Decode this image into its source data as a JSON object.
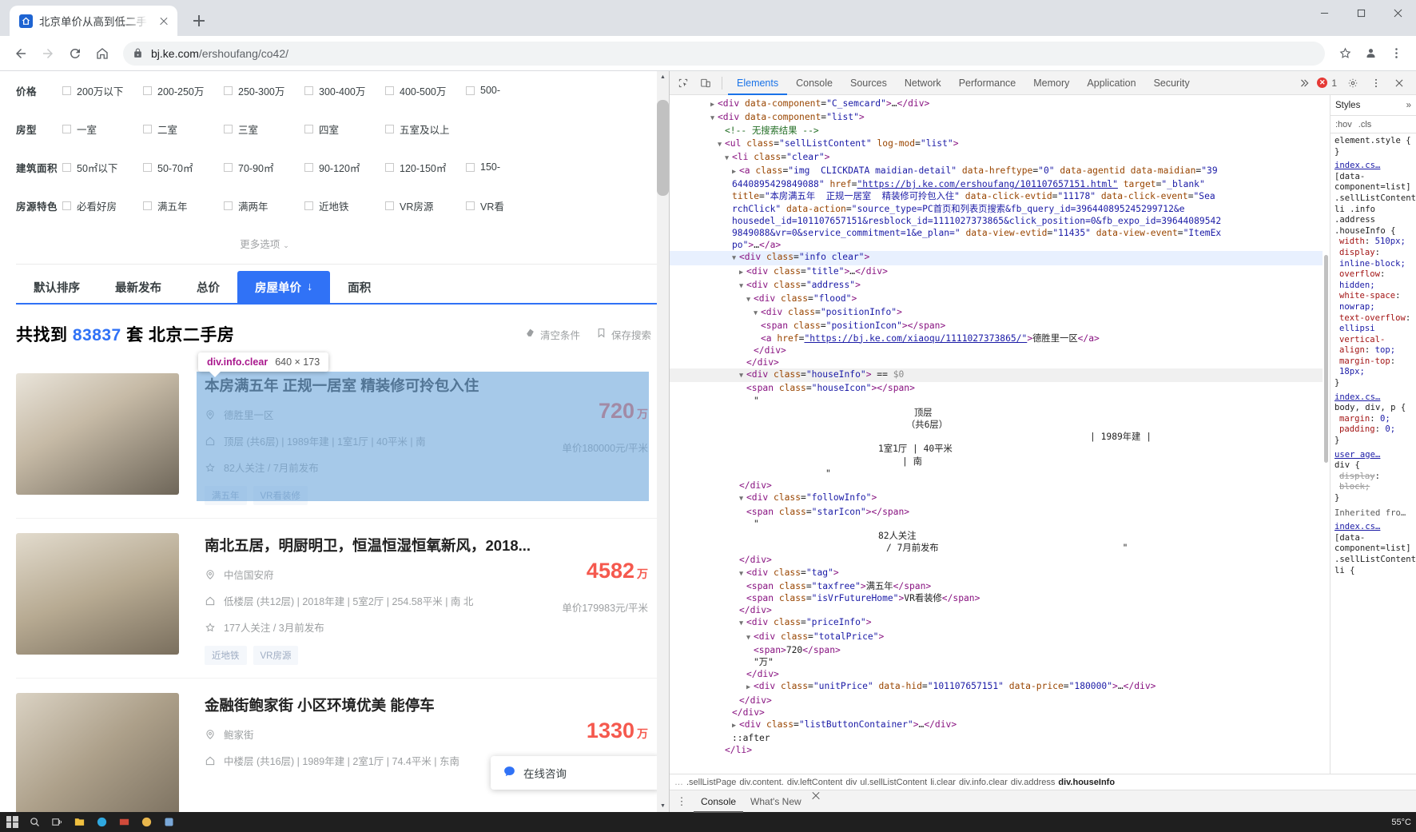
{
  "browser": {
    "tab_title": "北京单价从高到低二手房_北京单",
    "new_tab_label": "+",
    "url_host": "bj.ke.com",
    "url_path": "/ershoufang/co42/",
    "back_icon": "back-arrow-icon",
    "forward_icon": "forward-arrow-icon",
    "reload_icon": "reload-icon",
    "home_icon": "home-icon",
    "lock_icon": "lock-icon",
    "star_icon": "bookmark-star-icon",
    "profile_icon": "profile-avatar-icon",
    "menu_icon": "three-dot-menu-icon",
    "minimize_icon": "minimize-icon",
    "maximize_icon": "maximize-icon",
    "close_icon": "close-icon"
  },
  "filters": {
    "rows": [
      {
        "label": "价格",
        "items": [
          "200万以下",
          "200-250万",
          "250-300万",
          "300-400万",
          "400-500万",
          "500-"
        ]
      },
      {
        "label": "房型",
        "items": [
          "一室",
          "二室",
          "三室",
          "四室",
          "五室及以上",
          ""
        ]
      },
      {
        "label": "建筑面积",
        "items": [
          "50㎡以下",
          "50-70㎡",
          "70-90㎡",
          "90-120㎡",
          "120-150㎡",
          "150-"
        ]
      },
      {
        "label": "房源特色",
        "items": [
          "必看好房",
          "满五年",
          "满两年",
          "近地铁",
          "VR房源",
          "VR看"
        ]
      }
    ],
    "more_label": "更多选项",
    "more_chevron": "chevron-down-icon"
  },
  "sort": {
    "tabs": [
      {
        "label": "默认排序",
        "active": false
      },
      {
        "label": "最新发布",
        "active": false
      },
      {
        "label": "总价",
        "active": false
      },
      {
        "label": "房屋单价",
        "active": true,
        "arrow": "↓"
      },
      {
        "label": "面积",
        "active": false
      }
    ]
  },
  "results": {
    "prefix": "共找到",
    "count": "83837",
    "suffix": "套 北京二手房",
    "clear_label": "清空条件",
    "clear_icon": "eraser-icon",
    "save_label": "保存搜索",
    "save_icon": "bookmark-icon"
  },
  "listings": [
    {
      "title": "本房满五年 正规一居室 精装修可拎包入住",
      "community": "德胜里一区",
      "community_icon": "location-pin-icon",
      "detail": "顶层 (共6层) | 1989年建 | 1室1厅 | 40平米 | 南",
      "detail_icon": "house-icon",
      "follow": "82人关注 / 7月前发布",
      "follow_icon": "star-icon",
      "tags": [
        "满五年",
        "VR看装修"
      ],
      "total_price": "720",
      "total_unit": "万",
      "unit_price": "单价180000元/平米",
      "highlighted": true
    },
    {
      "title": "南北五居，明厨明卫，恒温恒湿恒氧新风，2018...",
      "community": "中信国安府",
      "community_icon": "location-pin-icon",
      "detail": "低楼层 (共12层) | 2018年建 | 5室2厅 | 254.58平米 | 南 北",
      "detail_icon": "house-icon",
      "follow": "177人关注 / 3月前发布",
      "follow_icon": "star-icon",
      "tags": [
        "近地铁",
        "VR房源"
      ],
      "total_price": "4582",
      "total_unit": "万",
      "unit_price": "单价179983元/平米",
      "highlighted": false
    },
    {
      "title": "金融街鲍家街 小区环境优美 能停车",
      "community": "鲍家街",
      "community_icon": "location-pin-icon",
      "detail": "中楼层 (共16层) | 1989年建 | 2室1厅 | 74.4平米 | 东南",
      "detail_icon": "house-icon",
      "follow": "",
      "follow_icon": "star-icon",
      "tags": [],
      "total_price": "1330",
      "total_unit": "万",
      "unit_price": "",
      "highlighted": false
    }
  ],
  "inspector_tooltip": {
    "selector": "div.info.clear",
    "dimensions": "640 × 173"
  },
  "chat_widget": {
    "label": "在线咨询",
    "icon": "chat-bubble-icon"
  },
  "devtools": {
    "inspect_icon": "inspect-element-icon",
    "device_icon": "device-toolbar-icon",
    "tabs": [
      {
        "label": "Elements",
        "active": true
      },
      {
        "label": "Console",
        "active": false
      },
      {
        "label": "Sources",
        "active": false
      },
      {
        "label": "Network",
        "active": false
      },
      {
        "label": "Performance",
        "active": false
      },
      {
        "label": "Memory",
        "active": false
      },
      {
        "label": "Application",
        "active": false
      },
      {
        "label": "Security",
        "active": false
      }
    ],
    "overflow_icon": "chevron-double-right-icon",
    "error_count": "1",
    "settings_icon": "gear-icon",
    "kebab_icon": "three-dot-menu-icon",
    "close_icon": "close-icon",
    "dom_lines": [
      {
        "indent": 5,
        "html": "<span class=\"tri\">▶</span><span class=\"tagc\">&lt;div</span> <span class=\"attr\">data-component</span>=<span class=\"val\">\"C_semcard\"</span><span class=\"tagc\">&gt;</span><span class=\"txt\">…</span><span class=\"tagc\">&lt;/div&gt;</span>",
        "state": ""
      },
      {
        "indent": 5,
        "html": "<span class=\"tri\">▼</span><span class=\"tagc\">&lt;div</span> <span class=\"attr\">data-component</span>=<span class=\"val\">\"list\"</span><span class=\"tagc\">&gt;</span>",
        "state": ""
      },
      {
        "indent": 7,
        "html": "<span class=\"cmt\">&lt;!-- 无搜索结果 --&gt;</span>",
        "state": ""
      },
      {
        "indent": 6,
        "html": "<span class=\"tri\">▼</span><span class=\"tagc\">&lt;ul</span> <span class=\"attr\">class</span>=<span class=\"val\">\"sellListContent\"</span> <span class=\"attr\">log-mod</span>=<span class=\"val\">\"list\"</span><span class=\"tagc\">&gt;</span>",
        "state": ""
      },
      {
        "indent": 7,
        "html": "<span class=\"tri\">▼</span><span class=\"tagc\">&lt;li</span> <span class=\"attr\">class</span>=<span class=\"val\">\"clear\"</span><span class=\"tagc\">&gt;</span>",
        "state": ""
      },
      {
        "indent": 8,
        "html": "<span class=\"tri\">▶</span><span class=\"tagc\">&lt;a</span> <span class=\"attr\">class</span>=<span class=\"val\">\"img  CLICKDATA maidian-detail\"</span> <span class=\"attr\">data-hreftype</span>=<span class=\"val\">\"0\"</span> <span class=\"attr\">data-agentid</span> <span class=\"attr\">data-maidian</span>=<span class=\"val\">\"39</span>",
        "state": ""
      },
      {
        "indent": 8,
        "html": "<span class=\"val\">6440895429849088\"</span> <span class=\"attr\">href</span>=<span class=\"lnk\">\"https://bj.ke.com/ershoufang/101107657151.html\"</span> <span class=\"attr\">target</span>=<span class=\"val\">\"_blank\"</span>",
        "state": ""
      },
      {
        "indent": 8,
        "html": "<span class=\"attr\">title</span>=<span class=\"val\">\"本房满五年  正规一居室  精装修可拎包入住\"</span> <span class=\"attr\">data-click-evtid</span>=<span class=\"val\">\"11178\"</span> <span class=\"attr\">data-click-event</span>=<span class=\"val\">\"Sea</span>",
        "state": ""
      },
      {
        "indent": 8,
        "html": "<span class=\"val\">rchClick\"</span> <span class=\"attr\">data-action</span>=<span class=\"val\">\"source_type=PC首页和列表页搜索&amp;fb_query_id=396440895245299712&amp;e</span>",
        "state": ""
      },
      {
        "indent": 8,
        "html": "<span class=\"val\">housedel_id=101107657151&amp;resblock_id=1111027373865&amp;click_position=0&amp;fb_expo_id=39644089542</span>",
        "state": ""
      },
      {
        "indent": 8,
        "html": "<span class=\"val\">9849088&amp;vr=0&amp;service_commitment=1&amp;e_plan=\"</span> <span class=\"attr\">data-view-evtid</span>=<span class=\"val\">\"11435\"</span> <span class=\"attr\">data-view-event</span>=<span class=\"val\">\"ItemEx</span>",
        "state": ""
      },
      {
        "indent": 8,
        "html": "<span class=\"val\">po\"</span><span class=\"tagc\">&gt;</span><span class=\"txt\">…</span><span class=\"tagc\">&lt;/a&gt;</span>",
        "state": ""
      },
      {
        "indent": 8,
        "html": "<span class=\"tri\">▼</span><span class=\"tagc\">&lt;div</span> <span class=\"attr\">class</span>=<span class=\"val\">\"info clear\"</span><span class=\"tagc\">&gt;</span>",
        "state": "sel"
      },
      {
        "indent": 9,
        "html": "<span class=\"tri\">▶</span><span class=\"tagc\">&lt;div</span> <span class=\"attr\">class</span>=<span class=\"val\">\"title\"</span><span class=\"tagc\">&gt;</span><span class=\"txt\">…</span><span class=\"tagc\">&lt;/div&gt;</span>",
        "state": ""
      },
      {
        "indent": 9,
        "html": "<span class=\"tri\">▼</span><span class=\"tagc\">&lt;div</span> <span class=\"attr\">class</span>=<span class=\"val\">\"address\"</span><span class=\"tagc\">&gt;</span>",
        "state": ""
      },
      {
        "indent": 10,
        "html": "<span class=\"tri\">▼</span><span class=\"tagc\">&lt;div</span> <span class=\"attr\">class</span>=<span class=\"val\">\"flood\"</span><span class=\"tagc\">&gt;</span>",
        "state": ""
      },
      {
        "indent": 11,
        "html": "<span class=\"tri\">▼</span><span class=\"tagc\">&lt;div</span> <span class=\"attr\">class</span>=<span class=\"val\">\"positionInfo\"</span><span class=\"tagc\">&gt;</span>",
        "state": ""
      },
      {
        "indent": 12,
        "html": "<span class=\"tagc\">&lt;span</span> <span class=\"attr\">class</span>=<span class=\"val\">\"positionIcon\"</span><span class=\"tagc\">&gt;&lt;/span&gt;</span>",
        "state": ""
      },
      {
        "indent": 12,
        "html": "<span class=\"tagc\">&lt;a</span> <span class=\"attr\">href</span>=<span class=\"lnk\">\"https://bj.ke.com/xiaoqu/1111027373865/\"</span><span class=\"tagc\">&gt;</span><span class=\"txt\">德胜里一区</span><span class=\"tagc\">&lt;/a&gt;</span>",
        "state": ""
      },
      {
        "indent": 11,
        "html": "<span class=\"tagc\">&lt;/div&gt;</span>",
        "state": ""
      },
      {
        "indent": 10,
        "html": "<span class=\"tagc\">&lt;/div&gt;</span>",
        "state": ""
      },
      {
        "indent": 9,
        "html": "<span class=\"tri\">▼</span><span class=\"tagc\">&lt;div</span> <span class=\"attr\">class</span>=<span class=\"val\">\"houseInfo\"</span><span class=\"tagc\">&gt;</span> == <span class=\"eq0\">$0</span>",
        "state": "sel2"
      },
      {
        "indent": 10,
        "html": "<span class=\"tagc\">&lt;span</span> <span class=\"attr\">class</span>=<span class=\"val\">\"houseIcon\"</span><span class=\"tagc\">&gt;&lt;/span&gt;</span>",
        "state": ""
      },
      {
        "indent": 11,
        "html": "<span class=\"txt\">\"</span>",
        "state": ""
      },
      {
        "indent": 0,
        "html": "<span class=\"txt\" style=\"margin-left:300px\">顶层</span>",
        "state": ""
      },
      {
        "indent": 0,
        "html": "<span class=\"txt\" style=\"margin-left:290px\">（共6层）</span>",
        "state": ""
      },
      {
        "indent": 0,
        "html": "<span class=\"txt\" style=\"margin-left:520px\">| 1989年建 |</span>",
        "state": ""
      },
      {
        "indent": 0,
        "html": "<span class=\"txt\" style=\"margin-left:255px\">1室1厅 | 40平米</span>",
        "state": ""
      },
      {
        "indent": 0,
        "html": "<span class=\"txt\" style=\"margin-left:285px\">| 南</span>",
        "state": ""
      },
      {
        "indent": 11,
        "html": "<span class=\"txt\" style=\"margin-left:90px\">\"</span>",
        "state": ""
      },
      {
        "indent": 9,
        "html": "<span class=\"tagc\">&lt;/div&gt;</span>",
        "state": ""
      },
      {
        "indent": 9,
        "html": "<span class=\"tri\">▼</span><span class=\"tagc\">&lt;div</span> <span class=\"attr\">class</span>=<span class=\"val\">\"followInfo\"</span><span class=\"tagc\">&gt;</span>",
        "state": ""
      },
      {
        "indent": 10,
        "html": "<span class=\"tagc\">&lt;span</span> <span class=\"attr\">class</span>=<span class=\"val\">\"starIcon\"</span><span class=\"tagc\">&gt;&lt;/span&gt;</span>",
        "state": ""
      },
      {
        "indent": 11,
        "html": "<span class=\"txt\">\"</span>",
        "state": ""
      },
      {
        "indent": 0,
        "html": "<span class=\"txt\" style=\"margin-left:255px\">82人关注</span>",
        "state": ""
      },
      {
        "indent": 0,
        "html": "<span class=\"txt\" style=\"margin-left:265px\">/ 7月前发布</span><span class=\"txt\" style=\"margin-left:230px\">\"</span>",
        "state": ""
      },
      {
        "indent": 9,
        "html": "<span class=\"tagc\">&lt;/div&gt;</span>",
        "state": ""
      },
      {
        "indent": 9,
        "html": "<span class=\"tri\">▼</span><span class=\"tagc\">&lt;div</span> <span class=\"attr\">class</span>=<span class=\"val\">\"tag\"</span><span class=\"tagc\">&gt;</span>",
        "state": ""
      },
      {
        "indent": 10,
        "html": "<span class=\"tagc\">&lt;span</span> <span class=\"attr\">class</span>=<span class=\"val\">\"taxfree\"</span><span class=\"tagc\">&gt;</span><span class=\"txt\">满五年</span><span class=\"tagc\">&lt;/span&gt;</span>",
        "state": ""
      },
      {
        "indent": 10,
        "html": "<span class=\"tagc\">&lt;span</span> <span class=\"attr\">class</span>=<span class=\"val\">\"isVrFutureHome\"</span><span class=\"tagc\">&gt;</span><span class=\"txt\">VR看装修</span><span class=\"tagc\">&lt;/span&gt;</span>",
        "state": ""
      },
      {
        "indent": 9,
        "html": "<span class=\"tagc\">&lt;/div&gt;</span>",
        "state": ""
      },
      {
        "indent": 9,
        "html": "<span class=\"tri\">▼</span><span class=\"tagc\">&lt;div</span> <span class=\"attr\">class</span>=<span class=\"val\">\"priceInfo\"</span><span class=\"tagc\">&gt;</span>",
        "state": ""
      },
      {
        "indent": 10,
        "html": "<span class=\"tri\">▼</span><span class=\"tagc\">&lt;div</span> <span class=\"attr\">class</span>=<span class=\"val\">\"totalPrice\"</span><span class=\"tagc\">&gt;</span>",
        "state": ""
      },
      {
        "indent": 11,
        "html": "<span class=\"tagc\">&lt;span&gt;</span><span class=\"txt\">720</span><span class=\"tagc\">&lt;/span&gt;</span>",
        "state": ""
      },
      {
        "indent": 11,
        "html": "<span class=\"txt\">\"万\"</span>",
        "state": ""
      },
      {
        "indent": 10,
        "html": "<span class=\"tagc\">&lt;/div&gt;</span>",
        "state": ""
      },
      {
        "indent": 10,
        "html": "<span class=\"tri\">▶</span><span class=\"tagc\">&lt;div</span> <span class=\"attr\">class</span>=<span class=\"val\">\"unitPrice\"</span> <span class=\"attr\">data-hid</span>=<span class=\"val\">\"101107657151\"</span> <span class=\"attr\">data-price</span>=<span class=\"val\">\"180000\"</span><span class=\"tagc\">&gt;</span><span class=\"txt\">…</span><span class=\"tagc\">&lt;/div&gt;</span>",
        "state": ""
      },
      {
        "indent": 9,
        "html": "<span class=\"tagc\">&lt;/div&gt;</span>",
        "state": ""
      },
      {
        "indent": 8,
        "html": "<span class=\"tagc\">&lt;/div&gt;</span>",
        "state": ""
      },
      {
        "indent": 8,
        "html": "<span class=\"tri\">▶</span><span class=\"tagc\">&lt;div</span> <span class=\"attr\">class</span>=<span class=\"val\">\"listButtonContainer\"</span><span class=\"tagc\">&gt;</span><span class=\"txt\">…</span><span class=\"tagc\">&lt;/div&gt;</span>",
        "state": ""
      },
      {
        "indent": 8,
        "html": "<span class=\"txt\">::after</span>",
        "state": ""
      },
      {
        "indent": 7,
        "html": "<span class=\"tagc\">&lt;/li&gt;</span>",
        "state": ""
      }
    ],
    "breadcrumbs": [
      {
        "label": "…",
        "active": false
      },
      {
        "label": ".sellListPage",
        "active": false
      },
      {
        "label": "div.content.",
        "active": false
      },
      {
        "label": "div.leftContent",
        "active": false
      },
      {
        "label": "div",
        "active": false
      },
      {
        "label": "ul.sellListContent",
        "active": false
      },
      {
        "label": "li.clear",
        "active": false
      },
      {
        "label": "div.info.clear",
        "active": false
      },
      {
        "label": "div.address",
        "active": false
      },
      {
        "label": "div.houseInfo",
        "active": true
      }
    ],
    "drawer": {
      "kebab": "⋮",
      "tabs": [
        {
          "label": "Console",
          "active": true
        },
        {
          "label": "What's New",
          "active": false
        }
      ]
    },
    "styles": {
      "title": "Styles",
      "expand_icon": "chevron-double-right-icon",
      "hov_label": ":hov",
      "cls_label": ".cls",
      "blocks": [
        {
          "type": "rule",
          "selector": "element.style {",
          "props": [],
          "close": "}"
        },
        {
          "type": "src",
          "text": "index.cs…"
        },
        {
          "type": "rule",
          "selector": "[data-component=list] .sellListContent li .info .address .houseInfo {",
          "props": [
            {
              "name": "width",
              "value": "510px;"
            },
            {
              "name": "display",
              "value": "inline-block;"
            },
            {
              "name": "overflow",
              "value": "hidden;"
            },
            {
              "name": "white-space",
              "value": "nowrap;"
            },
            {
              "name": "text-overflow",
              "value": "ellipsi"
            },
            {
              "name": "vertical-align",
              "value": "top;"
            },
            {
              "name": "margin-top",
              "value": "18px;"
            }
          ],
          "close": "}"
        },
        {
          "type": "src",
          "text": "index.cs…"
        },
        {
          "type": "rule",
          "selector": "body, div, p {",
          "props": [
            {
              "name": "margin",
              "value": "0;"
            },
            {
              "name": "padding",
              "value": "0;"
            }
          ],
          "close": "}"
        },
        {
          "type": "src",
          "text": "user age…"
        },
        {
          "type": "rule",
          "selector": "div {",
          "props": [
            {
              "name": "display",
              "value": "block;",
              "struck": true
            }
          ],
          "close": "}"
        },
        {
          "type": "label",
          "text": "Inherited fro…"
        },
        {
          "type": "src",
          "text": "index.cs…"
        },
        {
          "type": "rule",
          "selector": "[data-component=list] .sellListContent li {",
          "props": [],
          "close": ""
        }
      ]
    }
  },
  "taskbar": {
    "icons": [
      "start-icon",
      "search-icon",
      "taskview-icon",
      "folder-icon",
      "edge-icon",
      "mail-icon",
      "browser-icon",
      "app-icon"
    ],
    "temperature": "55°C"
  }
}
